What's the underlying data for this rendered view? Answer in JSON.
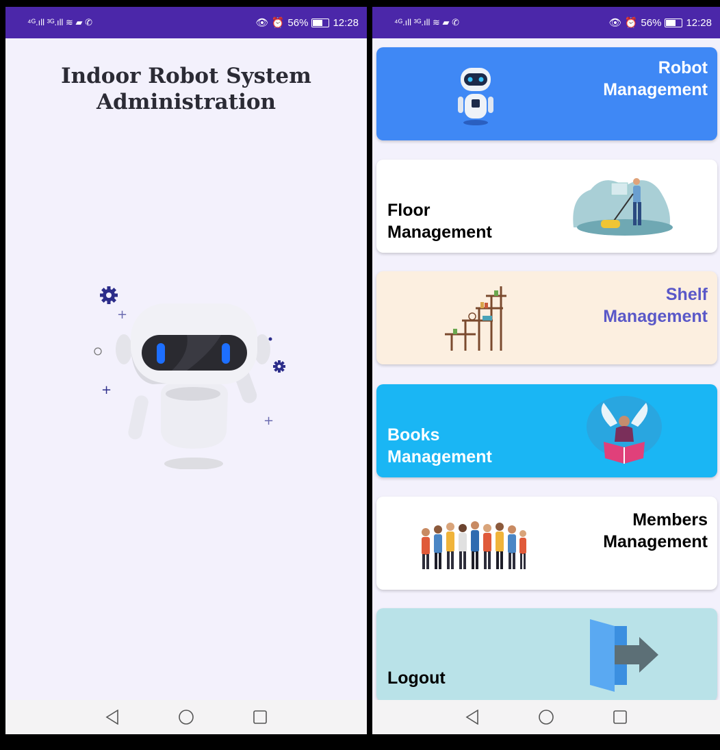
{
  "status_bar": {
    "left_icons": "⁴ᴳ.ıll ³ᴳ.ıll ≋ ▰ ✆",
    "right_icons": "👁 ⏰",
    "battery": "56%",
    "time": "12:28"
  },
  "splash": {
    "title_line1": "Indoor Robot System",
    "title_line2": "Administration"
  },
  "menu": {
    "robot": {
      "line1": "Robot",
      "line2": "Management"
    },
    "floor": {
      "line1": "Floor",
      "line2": "Management"
    },
    "shelf": {
      "line1": "Shelf",
      "line2": "Management"
    },
    "books": {
      "line1": "Books",
      "line2": "Management"
    },
    "members": {
      "line1": "Members",
      "line2": "Management"
    },
    "logout": {
      "label": "Logout"
    }
  },
  "colors": {
    "status_bar": "#4b27a9",
    "robot_card": "#3f88f5",
    "floor_card": "#ffffff",
    "shelf_card": "#fcefe0",
    "books_card": "#1ab6f4",
    "members_card": "#ffffff",
    "logout_card": "#b9e2e8",
    "shelf_text": "#5a58c8"
  },
  "nav": {
    "icons": [
      "back-triangle",
      "home-circle",
      "recents-square"
    ]
  }
}
